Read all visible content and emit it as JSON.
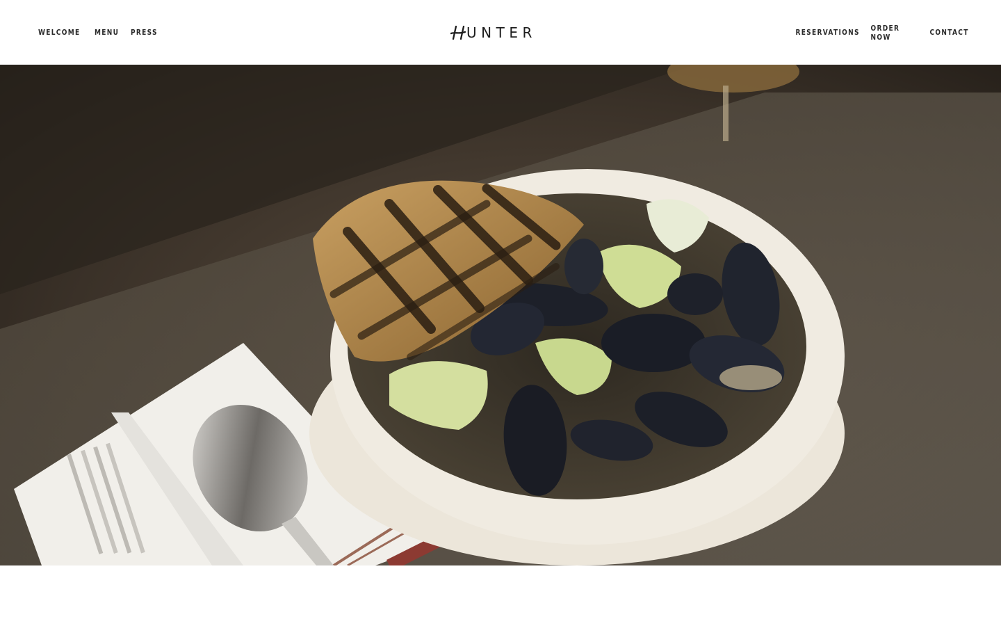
{
  "header": {
    "nav_left": [
      {
        "label": "WELCOME"
      },
      {
        "label": "MENU"
      },
      {
        "label": "PRESS"
      }
    ],
    "logo": {
      "glyph": "H",
      "text": "UNTER"
    },
    "nav_right": [
      {
        "label": "RESERVATIONS"
      },
      {
        "label": "ORDER NOW"
      },
      {
        "label": "CONTACT"
      }
    ]
  },
  "hero": {
    "image_subject": "mussels-bowl-with-grilled-bread-photo"
  },
  "colors": {
    "text": "#2a2a2a",
    "background": "#ffffff"
  }
}
